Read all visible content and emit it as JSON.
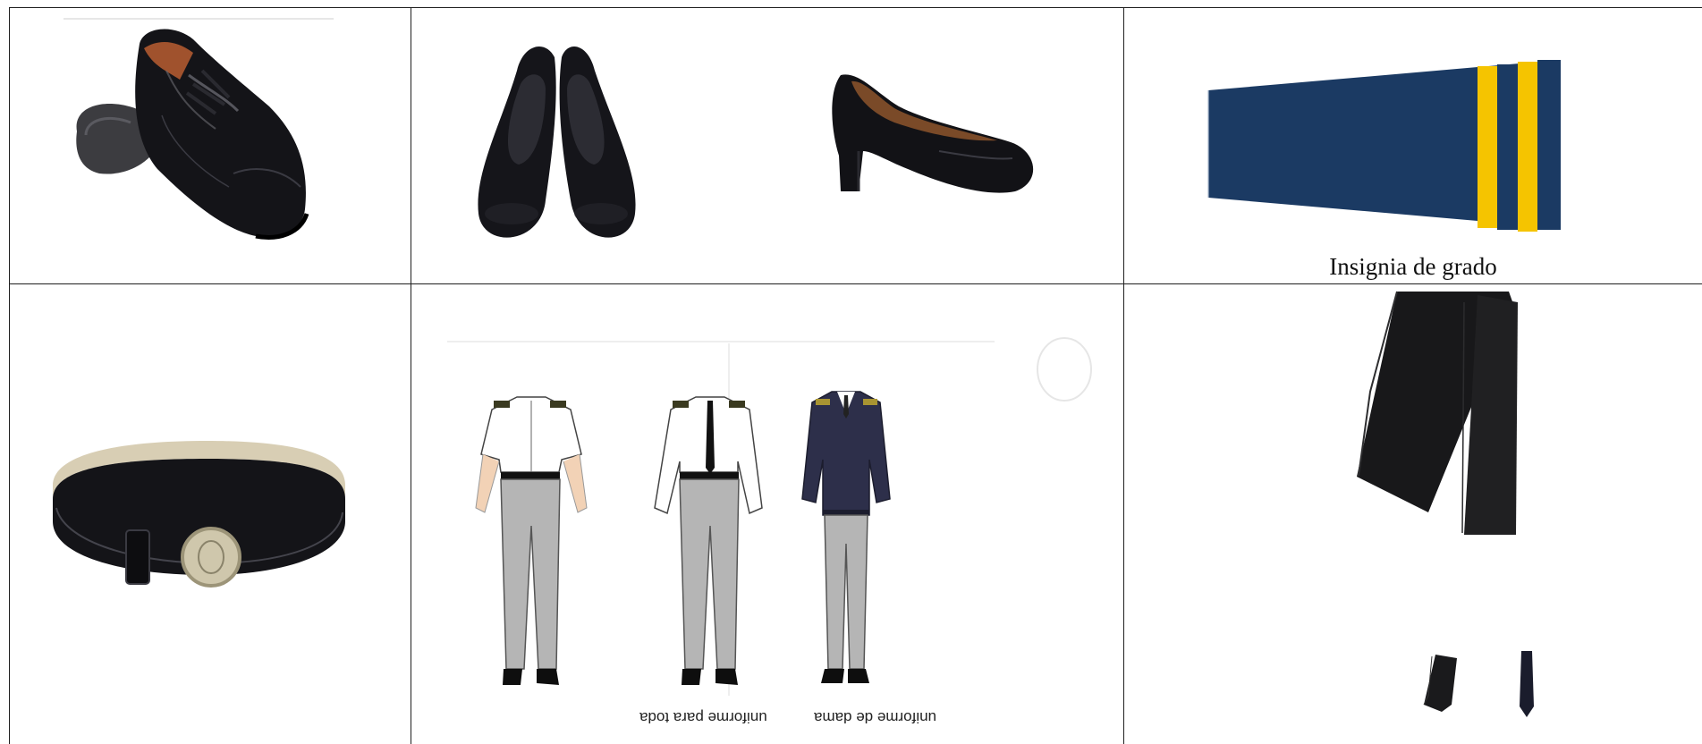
{
  "document": {
    "cells": [
      {
        "id": "oxford-shoe",
        "caption": ""
      },
      {
        "id": "women-pumps",
        "caption": ""
      },
      {
        "id": "rank-insignia",
        "caption": "Insignia de grado"
      },
      {
        "id": "belt",
        "caption": ""
      },
      {
        "id": "uniform-figures",
        "caption": ""
      },
      {
        "id": "necktie",
        "caption": ""
      }
    ],
    "mirrored_labels": {
      "left": "uniforme para toda",
      "right": "uniforme de dama"
    }
  },
  "colors": {
    "insignia_navy": "#1b3a63",
    "insignia_gold": "#f5c400",
    "trouser_gray": "#b5b5b5",
    "sweater_navy": "#2d2f4a"
  }
}
